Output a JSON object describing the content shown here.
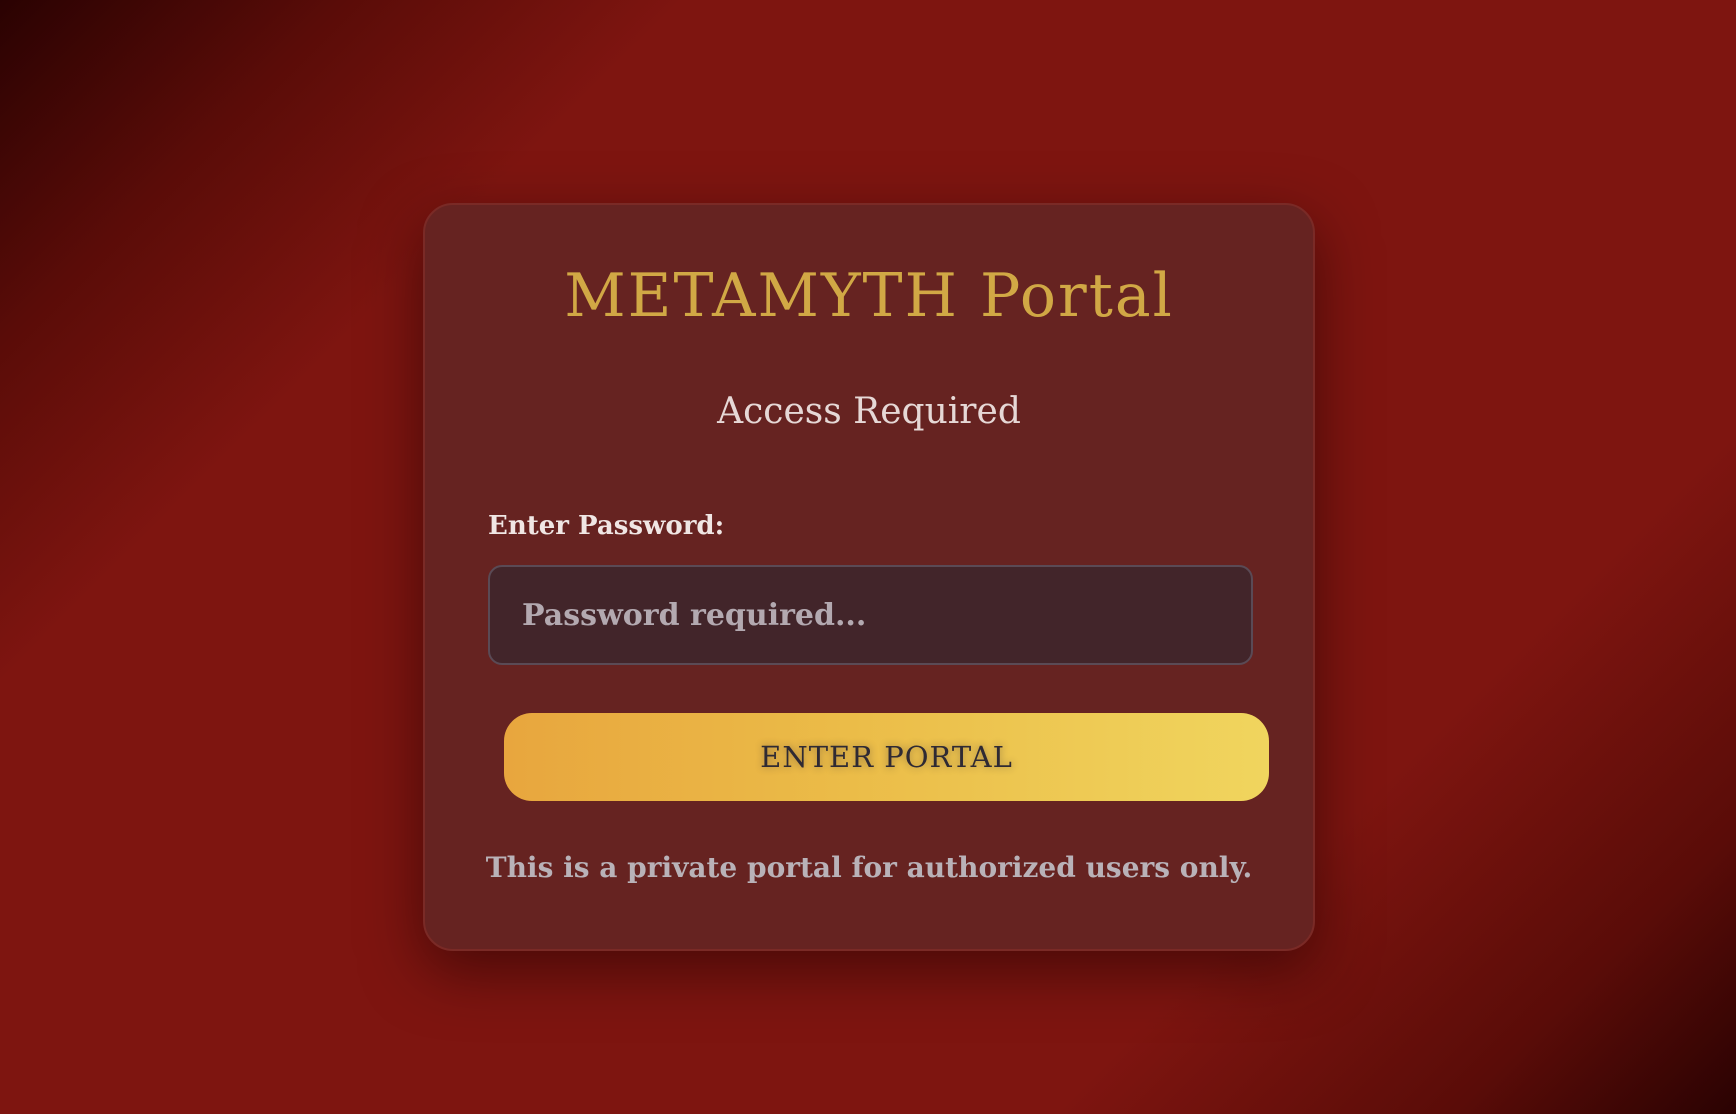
{
  "portal": {
    "title": "METAMYTH Portal",
    "subtitle": "Access Required",
    "password_label": "Enter Password:",
    "password_placeholder": "Password required...",
    "submit_label": "ENTER PORTAL",
    "notice": "This is a private portal for authorized users only."
  },
  "colors": {
    "background": "#7e1510",
    "card": "#662321",
    "title": "#d1a845",
    "button_start": "#e8a63e",
    "button_end": "#f0d55e"
  }
}
